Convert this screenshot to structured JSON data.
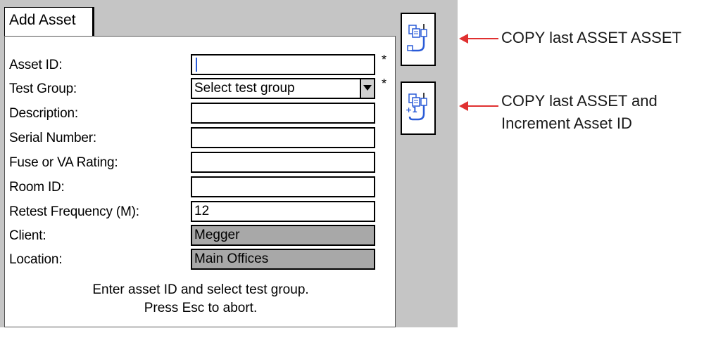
{
  "tab": {
    "label": "Add Asset"
  },
  "fields": [
    {
      "label": "Asset ID:",
      "value": "",
      "required_mark": "*"
    },
    {
      "label": "Test Group:",
      "value": "Select test group",
      "required_mark": "*"
    },
    {
      "label": "Description:",
      "value": ""
    },
    {
      "label": "Serial Number:",
      "value": ""
    },
    {
      "label": "Fuse or VA Rating:",
      "value": ""
    },
    {
      "label": "Room ID:",
      "value": ""
    },
    {
      "label": "Retest Frequency (M):",
      "value": "12"
    },
    {
      "label": "Client:",
      "value": "Megger"
    },
    {
      "label": "Location:",
      "value": "Main Offices"
    }
  ],
  "message": {
    "line1": "Enter asset ID and select test group.",
    "line2": "Press Esc to abort."
  },
  "buttons": {
    "copy_icon": "copy-asset-icon",
    "copy_increment_icon": "copy-increment-asset-icon",
    "increment_glyph": "+1"
  },
  "annotations": {
    "copy": "COPY last ASSET ASSET",
    "copy_increment_line1": "COPY last ASSET and",
    "copy_increment_line2": "Increment Asset ID"
  },
  "colors": {
    "arrow": "#e03030",
    "readonly_field": "#a8a8a8",
    "screen_bg": "#c5c5c5",
    "icon_blue": "#2a5bd7"
  }
}
